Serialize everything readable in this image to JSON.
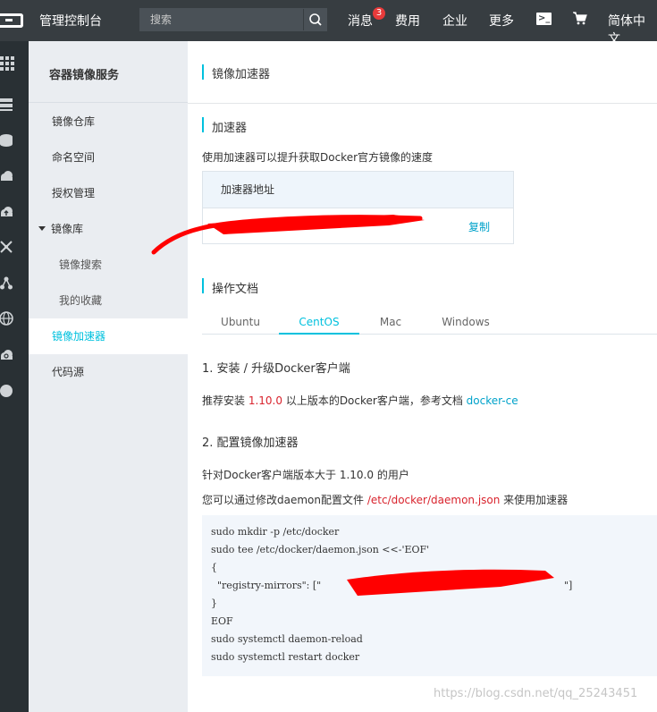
{
  "topbar": {
    "title": "管理控制台",
    "search_placeholder": "搜索",
    "nav": {
      "messages": "消息",
      "messages_badge": "3",
      "billing": "费用",
      "enterprise": "企业",
      "more": "更多",
      "language": "简体中文"
    }
  },
  "sidebar": {
    "title": "容器镜像服务",
    "items": [
      {
        "label": "镜像仓库"
      },
      {
        "label": "命名空间"
      },
      {
        "label": "授权管理"
      },
      {
        "label": "镜像库"
      },
      {
        "label": "镜像搜索"
      },
      {
        "label": "我的收藏"
      },
      {
        "label": "镜像加速器"
      },
      {
        "label": "代码源"
      }
    ]
  },
  "main": {
    "page_title": "镜像加速器",
    "accelerator": {
      "title": "加速器",
      "description": "使用加速器可以提升获取Docker官方镜像的速度",
      "header": "加速器地址",
      "copy": "复制"
    },
    "docs": {
      "title": "操作文档",
      "tabs": [
        "Ubuntu",
        "CentOS",
        "Mac",
        "Windows"
      ],
      "active_tab": "CentOS",
      "step1_title": "1. 安装 / 升级Docker客户端",
      "step1_text_a": "推荐安装 ",
      "step1_version": "1.10.0",
      "step1_text_b": " 以上版本的Docker客户端，参考文档 ",
      "step1_link": "docker-ce",
      "step2_title": "2. 配置镜像加速器",
      "step2_line1": "针对Docker客户端版本大于 1.10.0 的用户",
      "step2_line2_a": "您可以通过修改daemon配置文件 ",
      "step2_line2_path": "/etc/docker/daemon.json",
      "step2_line2_b": " 来使用加速器",
      "code": [
        "sudo mkdir -p /etc/docker",
        "sudo tee /etc/docker/daemon.json <<-'EOF'",
        "{",
        "  \"registry-mirrors\": [\"",
        "}",
        "EOF",
        "sudo systemctl daemon-reload",
        "sudo systemctl restart docker"
      ],
      "code_line4_end": "\"]"
    }
  },
  "watermark": "https://blog.csdn.net/qq_25243451",
  "colors": {
    "accent": "#00c1de",
    "link": "#00a2ca",
    "topbar": "#373d41",
    "rail": "#293034",
    "sidebar": "#eaedf1",
    "redaction": "#ff0000"
  }
}
